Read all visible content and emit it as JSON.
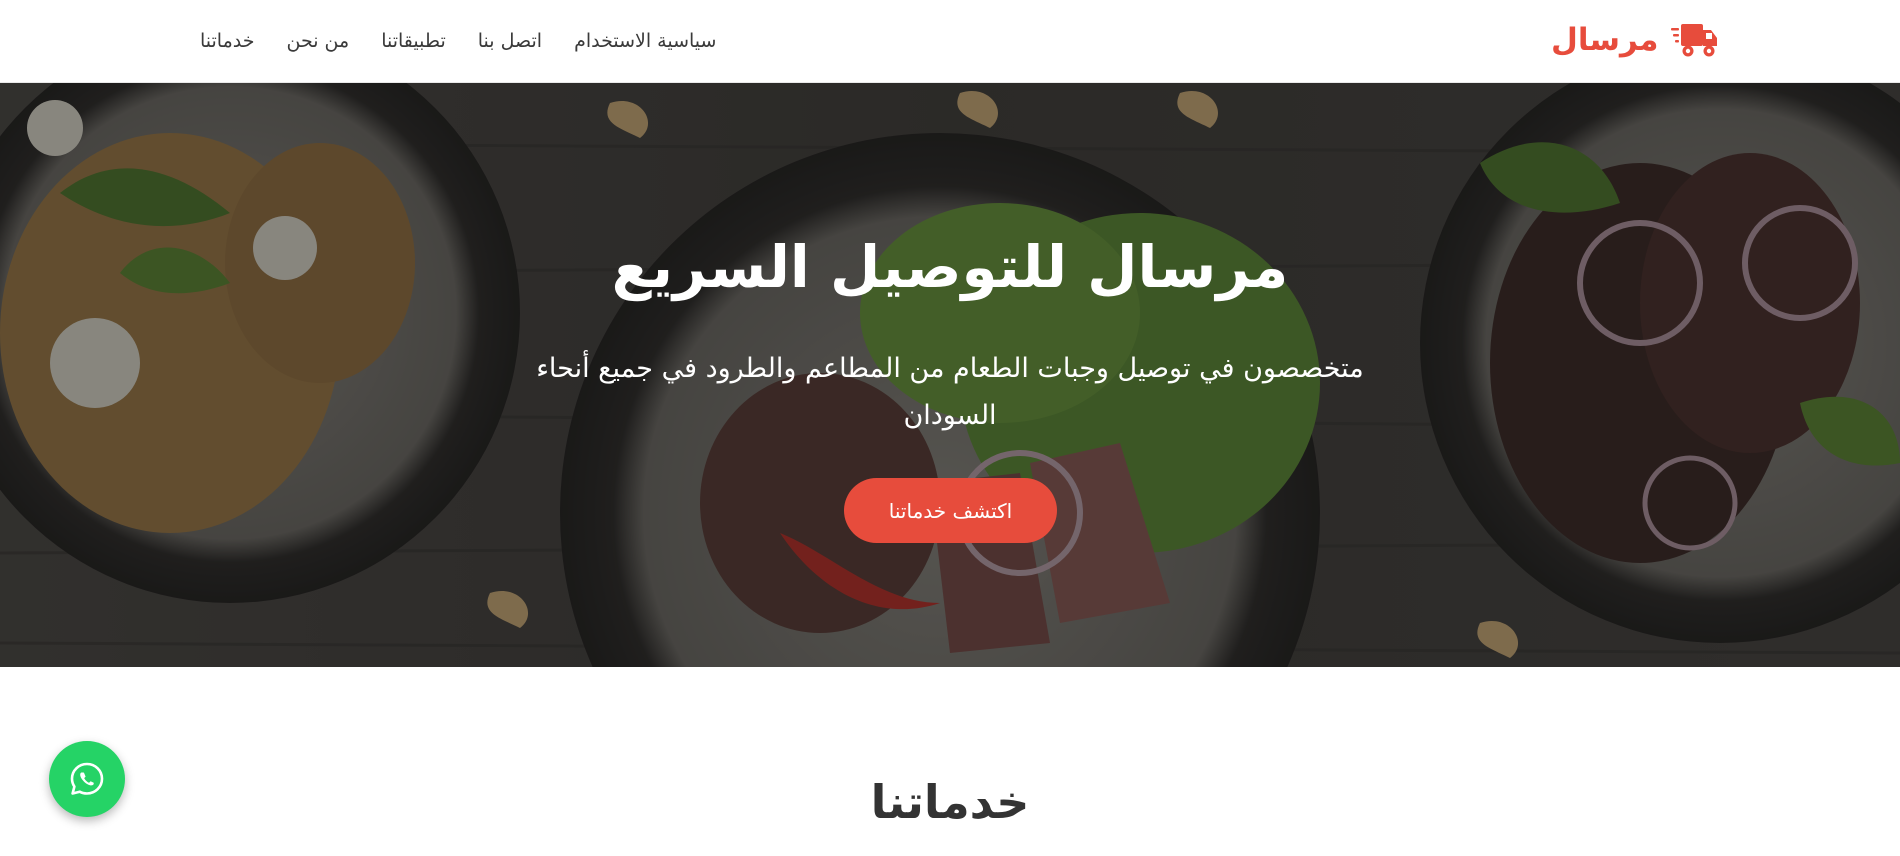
{
  "header": {
    "brand": {
      "name": "مرسال",
      "icon": "delivery-truck-icon"
    },
    "nav": [
      {
        "label": "خدماتنا",
        "name": "nav-services"
      },
      {
        "label": "من نحن",
        "name": "nav-about"
      },
      {
        "label": "تطبيقاتنا",
        "name": "nav-apps"
      },
      {
        "label": "اتصل بنا",
        "name": "nav-contact"
      },
      {
        "label": "سياسية الاستخدام",
        "name": "nav-usage-policy"
      }
    ]
  },
  "hero": {
    "title": "مرسال للتوصيل السريع",
    "subtitle": "متخصصون في توصيل وجبات الطعام من المطاعم والطرود في جميع أنحاء السودان",
    "button_label": "اكتشف خدماتنا"
  },
  "services": {
    "title": "خدماتنا"
  },
  "floating": {
    "whatsapp_icon": "whatsapp-icon"
  },
  "colors": {
    "accent": "#e74c3c",
    "whatsapp": "#25d366",
    "text": "#333333"
  }
}
